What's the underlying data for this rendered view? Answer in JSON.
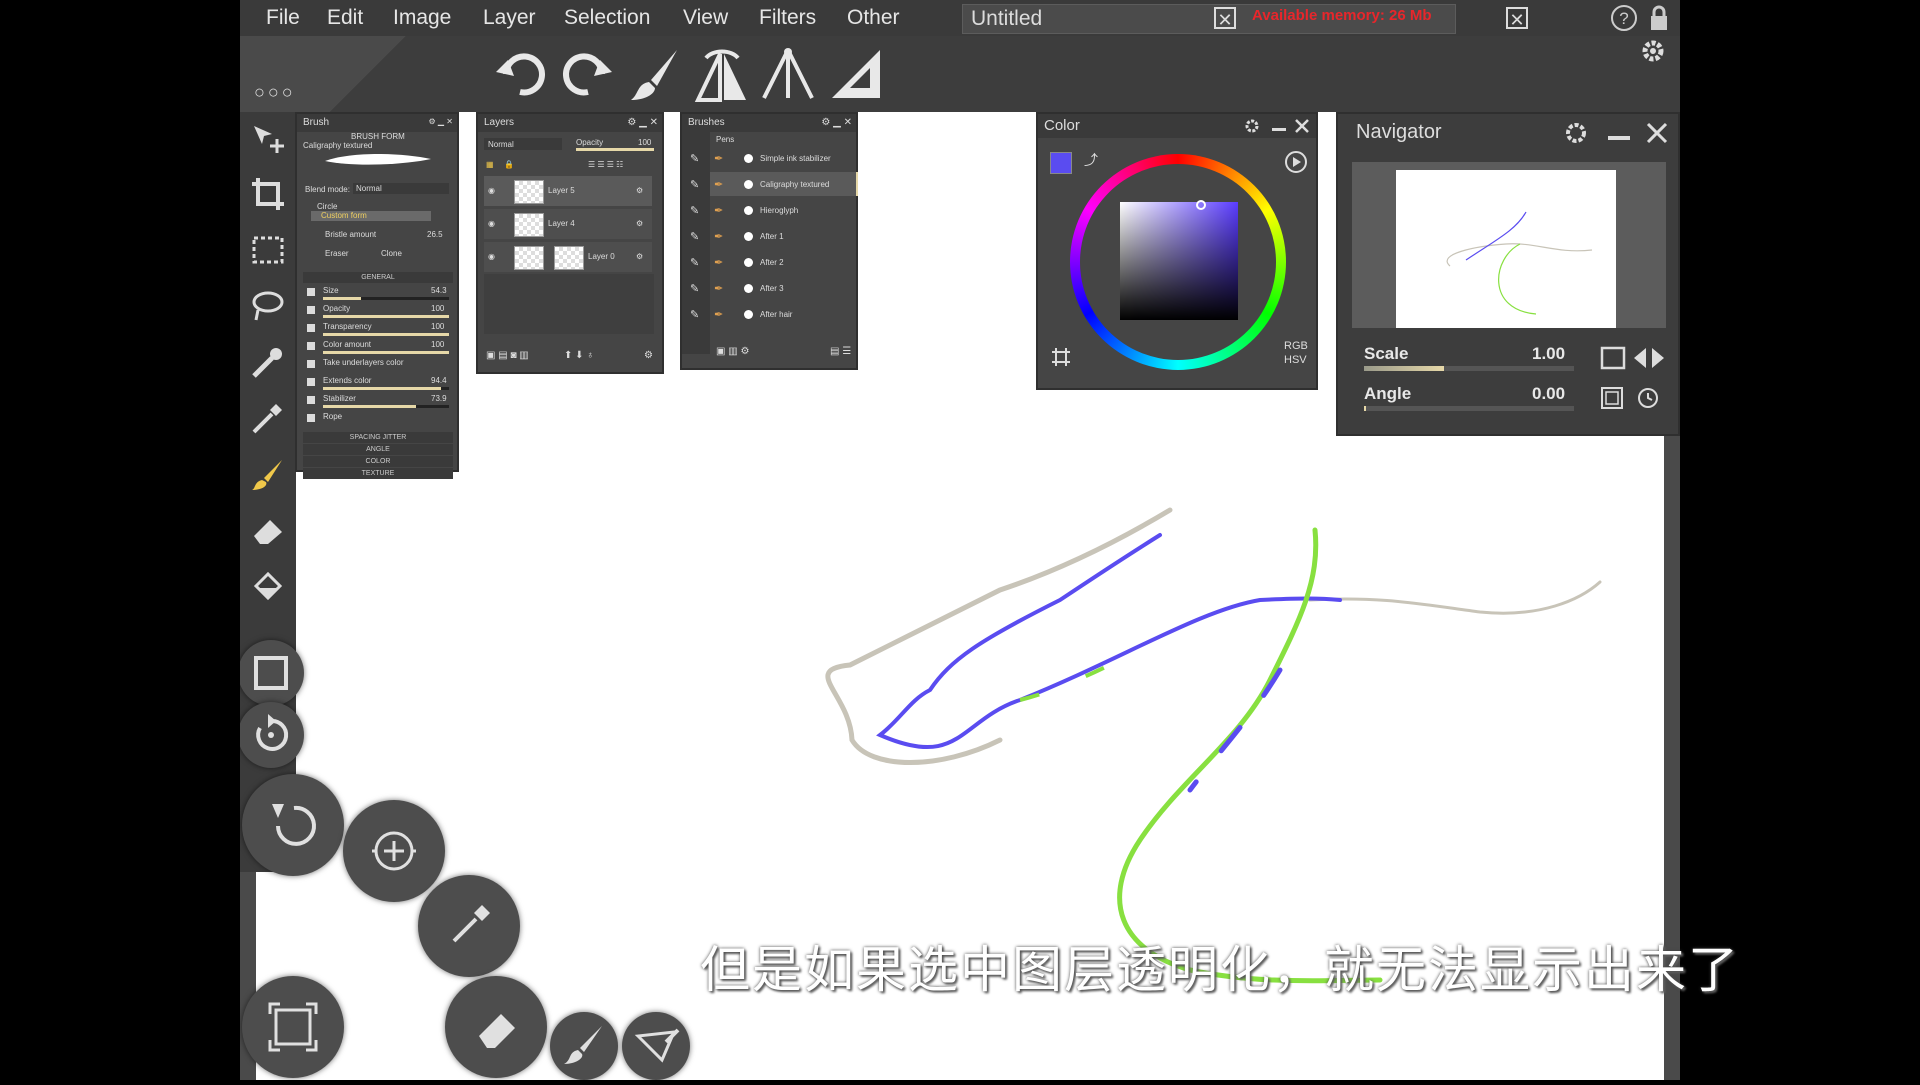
{
  "menu": {
    "items": [
      "File",
      "Edit",
      "Image",
      "Layer",
      "Selection",
      "View",
      "Filters",
      "Other"
    ],
    "doc_title": "Untitled",
    "memory_text": "Available memory: 26 Mb"
  },
  "brush_panel": {
    "title": "Brush",
    "section_brush_form": "BRUSH FORM",
    "brush_name": "Caligraphy textured",
    "blend_label": "Blend mode:",
    "blend_value": "Normal",
    "shape_circle": "Circle",
    "shape_custom": "Custom form",
    "bristle_label": "Bristle amount",
    "bristle_value": "26.5",
    "eraser": "Eraser",
    "clone": "Clone",
    "section_general": "GENERAL",
    "params": [
      {
        "label": "Size",
        "value": "54.3",
        "fill": 0.3
      },
      {
        "label": "Opacity",
        "value": "100",
        "fill": 1.0
      },
      {
        "label": "Transparency",
        "value": "100",
        "fill": 1.0
      },
      {
        "label": "Color amount",
        "value": "100",
        "fill": 1.0
      },
      {
        "label": "Take underlayers color",
        "value": "",
        "fill": 0
      },
      {
        "label": "Extends color",
        "value": "94.4",
        "fill": 0.94
      },
      {
        "label": "Stabilizer",
        "value": "73.9",
        "fill": 0.74
      },
      {
        "label": "Rope",
        "value": "",
        "fill": 0
      }
    ],
    "sections": [
      "SPACING JITTER",
      "ANGLE",
      "COLOR",
      "TEXTURE"
    ]
  },
  "layers_panel": {
    "title": "Layers",
    "blend": "Normal",
    "opacity_label": "Opacity",
    "opacity_value": "100",
    "layers": [
      "Layer 5",
      "Layer 4",
      "Layer 0"
    ]
  },
  "brushes_panel": {
    "title": "Brushes",
    "category": "Pens",
    "items": [
      "Simple ink stabilizer",
      "Caligraphy textured",
      "Hieroglyph",
      "After 1",
      "After 2",
      "After 3",
      "After hair"
    ]
  },
  "color_panel": {
    "title": "Color",
    "current_color": "#5a4cf0",
    "mode_rgb": "RGB",
    "mode_hsv": "HSV"
  },
  "navigator_panel": {
    "title": "Navigator",
    "scale_label": "Scale",
    "scale_value": "1.00",
    "scale_fraction": 0.38,
    "angle_label": "Angle",
    "angle_value": "0.00",
    "angle_fraction": 0.0
  },
  "subtitle": "但是如果选中图层透明化，就无法显示出来了",
  "colors": {
    "stroke_blue": "#5a4cf0",
    "stroke_green": "#88e040",
    "stroke_grey": "#c8c4b8"
  }
}
